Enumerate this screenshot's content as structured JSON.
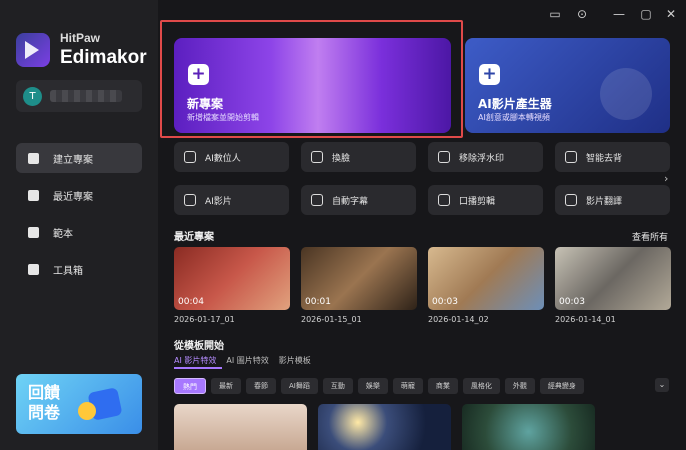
{
  "app": {
    "brand_small": "HitPaw",
    "brand_big": "Edimakor"
  },
  "user": {
    "avatar_letter": "T"
  },
  "sidebar": {
    "items": [
      {
        "label": "建立專案",
        "icon": "create-icon",
        "active": true
      },
      {
        "label": "最近專案",
        "icon": "folder-icon",
        "active": false
      },
      {
        "label": "範本",
        "icon": "template-icon",
        "active": false
      },
      {
        "label": "工具箱",
        "icon": "toolbox-icon",
        "active": false
      }
    ]
  },
  "promo": {
    "text": "回饋問卷"
  },
  "titlebar": {
    "icons": [
      "feedback-icon",
      "settings-icon",
      "minimize-icon",
      "maximize-icon",
      "close-icon"
    ],
    "glyphs": [
      "▭",
      "⊙",
      "—",
      "▢",
      "✕"
    ]
  },
  "cards": [
    {
      "title": "新專案",
      "subtitle": "新增檔案並開始剪輯",
      "plus": "+"
    },
    {
      "title": "AI影片產生器",
      "subtitle": "AI創意或腳本轉視頻",
      "plus": "+"
    }
  ],
  "tools": [
    {
      "label": "AI數位人"
    },
    {
      "label": "換臉"
    },
    {
      "label": "移除浮水印"
    },
    {
      "label": "智能去背"
    },
    {
      "label": "AI影片"
    },
    {
      "label": "自動字幕"
    },
    {
      "label": "口播剪輯"
    },
    {
      "label": "影片翻譯"
    }
  ],
  "recent": {
    "title": "最近專案",
    "see_all": "查看所有",
    "items": [
      {
        "name": "2026-01-17_01",
        "duration": "00:04"
      },
      {
        "name": "2026-01-15_01",
        "duration": "00:01"
      },
      {
        "name": "2026-01-14_02",
        "duration": "00:03"
      },
      {
        "name": "2026-01-14_01",
        "duration": "00:03"
      }
    ]
  },
  "templates": {
    "title": "從模板開始",
    "tabs": [
      "AI 影片特效",
      "AI 圖片特效",
      "影片模板"
    ],
    "chips": [
      "熱門",
      "最新",
      "春節",
      "AI舞蹈",
      "互動",
      "娛樂",
      "萌寵",
      "商業",
      "風格化",
      "外觀",
      "經典變身"
    ],
    "more": "⌄",
    "arrow": "›"
  }
}
